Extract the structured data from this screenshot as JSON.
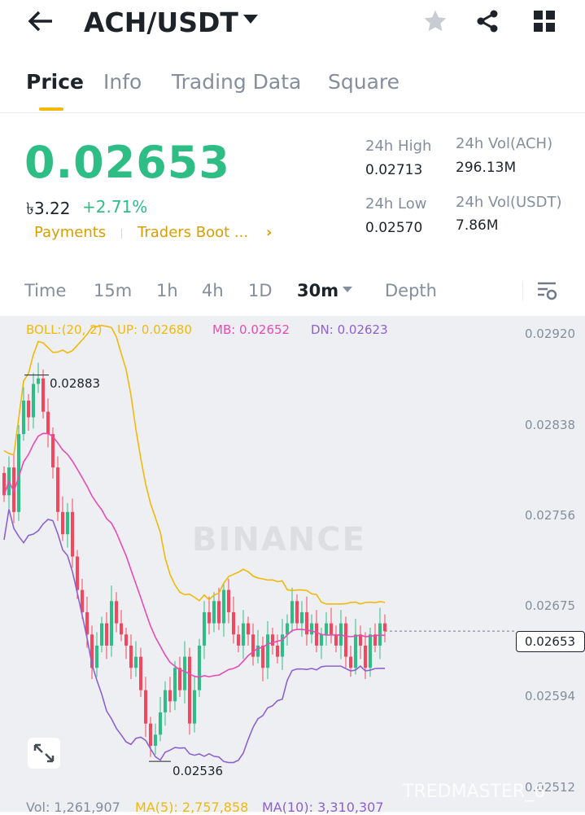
{
  "header": {
    "title": "ACH/USDT",
    "back_icon": "arrow-left-icon",
    "icons": [
      "star-icon",
      "share-icon",
      "grid-icon"
    ]
  },
  "tabs": [
    {
      "label": "Price",
      "active": true
    },
    {
      "label": "Info"
    },
    {
      "label": "Trading Data"
    },
    {
      "label": "Square"
    }
  ],
  "ticker": {
    "price": "0.02653",
    "fiat": "৳3.22",
    "change": "+2.71%",
    "links": [
      "Payments",
      "Traders Boot ..."
    ],
    "stats": {
      "high_label": "24h High",
      "high": "0.02713",
      "low_label": "24h Low",
      "low": "0.02570",
      "vol_base_label": "24h Vol(ACH)",
      "vol_base": "296.13M",
      "vol_quote_label": "24h Vol(USDT)",
      "vol_quote": "7.86M"
    }
  },
  "timeframes": [
    "Time",
    "15m",
    "1h",
    "4h",
    "1D",
    "30m",
    "Depth"
  ],
  "active_timeframe": "30m",
  "colors": {
    "up": "#2ebd85",
    "down": "#f6465d",
    "boll_up": "#f0b90b",
    "boll_mb": "#e84bb4",
    "boll_dn": "#8c62d0",
    "accent": "#f0b90b"
  },
  "chart_data": {
    "type": "candlestick",
    "legend": {
      "boll": "BOLL:(20, 2)",
      "up": "UP: 0.02680",
      "mb": "MB: 0.02652",
      "dn": "DN: 0.02623"
    },
    "y_ticks": [
      "0.02920",
      "0.02838",
      "0.02756",
      "0.02675",
      "0.02594",
      "0.02512"
    ],
    "ylim": [
      0.02512,
      0.0292
    ],
    "high_label": "0.02883",
    "low_label": "0.02536",
    "current": "0.02653",
    "closes": [
      0.02775,
      0.028,
      0.0276,
      0.0283,
      0.0286,
      0.02845,
      0.02875,
      0.0288,
      0.0285,
      0.0283,
      0.028,
      0.0276,
      0.0274,
      0.0276,
      0.0272,
      0.0269,
      0.0267,
      0.0265,
      0.0262,
      0.0264,
      0.0266,
      0.0264,
      0.0268,
      0.0266,
      0.0265,
      0.0264,
      0.0262,
      0.0263,
      0.026,
      0.0257,
      0.0255,
      0.0256,
      0.0258,
      0.026,
      0.0259,
      0.0262,
      0.026,
      0.0263,
      0.0257,
      0.026,
      0.0264,
      0.0267,
      0.0266,
      0.0268,
      0.0266,
      0.0269,
      0.0267,
      0.0265,
      0.0264,
      0.0266,
      0.0265,
      0.0263,
      0.0264,
      0.0262,
      0.0265,
      0.0264,
      0.0263,
      0.0265,
      0.0266,
      0.0268,
      0.0266,
      0.0267,
      0.0265,
      0.0266,
      0.0264,
      0.0265,
      0.0266,
      0.0265,
      0.0264,
      0.0266,
      0.0263,
      0.0262,
      0.0265,
      0.0264,
      0.0262,
      0.0265,
      0.0264,
      0.0266,
      0.02653
    ],
    "volume": {
      "vol": "Vol: 1,261,907",
      "ma5": "MA(5): 2,757,858",
      "ma10": "MA(10): 3,310,307"
    }
  },
  "watermark": "BINANCE",
  "overlay_watermark": "TREDMASTER_6"
}
